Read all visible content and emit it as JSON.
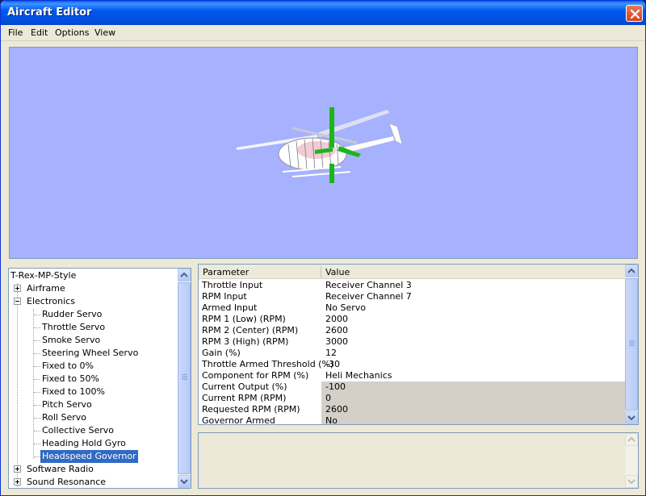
{
  "window": {
    "title": "Aircraft Editor"
  },
  "menu": [
    "File",
    "Edit",
    "Options",
    "View"
  ],
  "tree": {
    "root": "T-Rex-MP-Style",
    "items": [
      {
        "label": "Airframe",
        "level": 1,
        "expander": "plus"
      },
      {
        "label": "Electronics",
        "level": 1,
        "expander": "minus"
      },
      {
        "label": "Rudder Servo",
        "level": 2
      },
      {
        "label": "Throttle Servo",
        "level": 2
      },
      {
        "label": "Smoke Servo",
        "level": 2
      },
      {
        "label": "Steering Wheel Servo",
        "level": 2
      },
      {
        "label": "Fixed to 0%",
        "level": 2
      },
      {
        "label": "Fixed to 50%",
        "level": 2
      },
      {
        "label": "Fixed to 100%",
        "level": 2
      },
      {
        "label": "Pitch Servo",
        "level": 2
      },
      {
        "label": "Roll Servo",
        "level": 2
      },
      {
        "label": "Collective Servo",
        "level": 2
      },
      {
        "label": "Heading Hold Gyro",
        "level": 2
      },
      {
        "label": "Headspeed Governor",
        "level": 2,
        "selected": true
      },
      {
        "label": "Software Radio",
        "level": 1,
        "expander": "plus"
      },
      {
        "label": "Sound Resonance",
        "level": 1,
        "expander": "plus"
      }
    ]
  },
  "grid": {
    "columns": [
      "Parameter",
      "Value"
    ],
    "rows": [
      {
        "param": "Throttle Input",
        "value": "Receiver Channel 3"
      },
      {
        "param": "RPM Input",
        "value": "Receiver Channel 7"
      },
      {
        "param": "Armed Input",
        "value": "No Servo"
      },
      {
        "param": "RPM 1 (Low) (RPM)",
        "value": "2000"
      },
      {
        "param": "RPM 2 (Center) (RPM)",
        "value": "2600"
      },
      {
        "param": "RPM 3 (High) (RPM)",
        "value": "3000"
      },
      {
        "param": "Gain (%)",
        "value": "12"
      },
      {
        "param": "Throttle Armed Threshold (%)",
        "value": "-30"
      },
      {
        "param": "Component for RPM (%)",
        "value": "Heli Mechanics"
      },
      {
        "param": "Current Output (%)",
        "value": "-100",
        "readonly": true
      },
      {
        "param": "Current RPM (RPM)",
        "value": "0",
        "readonly": true
      },
      {
        "param": "Requested RPM (RPM)",
        "value": "2600",
        "readonly": true
      },
      {
        "param": "Governor Armed",
        "value": "No",
        "readonly": true
      }
    ]
  },
  "colors": {
    "viewport_background": "#a6b2fd",
    "selection": "#316ac5",
    "readonly_cell": "#d4d0c8"
  }
}
